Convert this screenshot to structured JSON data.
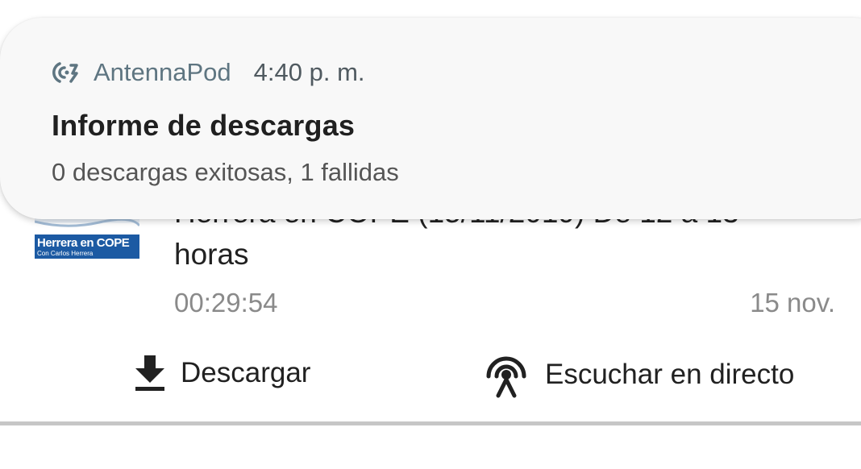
{
  "notification": {
    "app_icon": "antennapod-icon",
    "app_name": "AntennaPod",
    "time": "4:40 p. m.",
    "title": "Informe de descargas",
    "text": "0 descargas exitosas, 1 fallidas"
  },
  "episode": {
    "cover": {
      "title": "Herrera en COPE",
      "subtitle": "Con Carlos Herrera",
      "brand_color": "#1c5aa3"
    },
    "title": "Herrera en COPE (15/11/2019) De 12 a 13 horas",
    "duration": "00:29:54",
    "date": "15 nov."
  },
  "actions": {
    "download": {
      "icon": "download-icon",
      "label": "Descargar"
    },
    "stream": {
      "icon": "stream-icon",
      "label": "Escuchar en directo"
    }
  }
}
